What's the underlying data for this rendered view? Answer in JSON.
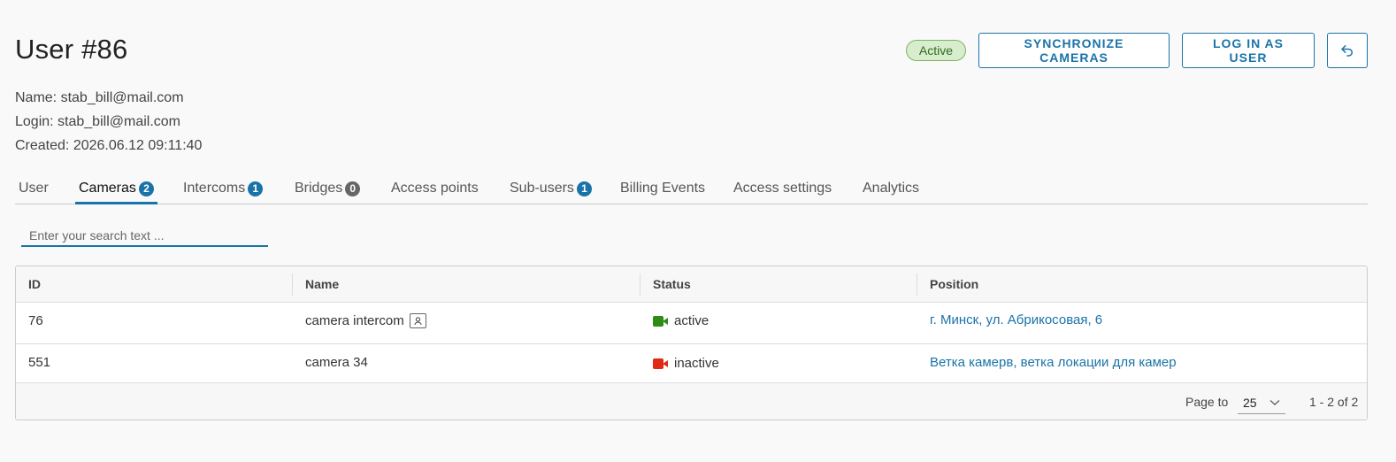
{
  "header": {
    "title": "User #86",
    "status": "Active",
    "sync_label": "SYNCHRONIZE CAMERAS",
    "login_label": "LOG IN AS USER",
    "back_icon": "undo-arrow-icon"
  },
  "info": {
    "name": "Name: stab_bill@mail.com",
    "login": "Login: stab_bill@mail.com",
    "created": "Created: 2026.06.12 09:11:40"
  },
  "tabs": [
    {
      "label": "User",
      "badge": null
    },
    {
      "label": "Cameras",
      "badge": "2"
    },
    {
      "label": "Intercoms",
      "badge": "1"
    },
    {
      "label": "Bridges",
      "badge": "0"
    },
    {
      "label": "Access points",
      "badge": null
    },
    {
      "label": "Sub-users",
      "badge": "1"
    },
    {
      "label": "Billing Events",
      "badge": null
    },
    {
      "label": "Access settings",
      "badge": null
    },
    {
      "label": "Analytics",
      "badge": null
    }
  ],
  "search": {
    "placeholder": "Enter your search text ..."
  },
  "table": {
    "columns": [
      "ID",
      "Name",
      "Status",
      "Position"
    ],
    "rows": [
      {
        "id": "76",
        "name": "camera intercom",
        "status": "active",
        "position": "г. Минск, ул. Абрикосовая, 6"
      },
      {
        "id": "551",
        "name": "camera 34",
        "status": "inactive",
        "position": "Ветка камерв, ветка локации для камер"
      }
    ]
  },
  "pagination": {
    "page_to_label": "Page to",
    "page_size": "25",
    "range": "1 - 2 of 2"
  },
  "colors": {
    "accent": "#1a73a8",
    "active": "#2e8b16",
    "inactive": "#e02a14"
  }
}
